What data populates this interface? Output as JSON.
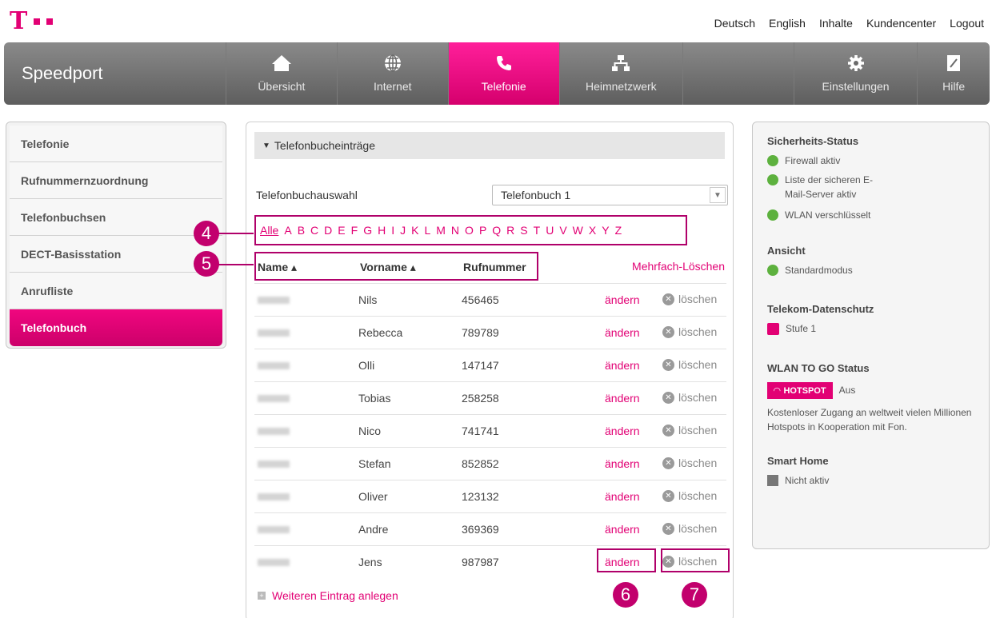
{
  "header": {
    "links": [
      "Deutsch",
      "English",
      "Inhalte",
      "Kundencenter",
      "Logout"
    ]
  },
  "nav": {
    "brand": "Speedport",
    "items": [
      {
        "label": "Übersicht",
        "icon": "home-icon"
      },
      {
        "label": "Internet",
        "icon": "globe-icon"
      },
      {
        "label": "Telefonie",
        "icon": "phone-icon",
        "active": true
      },
      {
        "label": "Heimnetzwerk",
        "icon": "network-icon"
      },
      {
        "label": "Einstellungen",
        "icon": "gear-icon"
      },
      {
        "label": "Hilfe",
        "icon": "help-book-icon"
      }
    ],
    "active_color": "#e20074"
  },
  "sidebar": {
    "items": [
      "Telefonie",
      "Rufnummernzuordnung",
      "Telefonbuchsen",
      "DECT-Basisstation",
      "Anrufliste",
      "Telefonbuch"
    ],
    "active": "Telefonbuch"
  },
  "panel": {
    "title": "Telefonbucheinträge",
    "select_label": "Telefonbuchauswahl",
    "select_value": "Telefonbuch 1",
    "alphabet": [
      "Alle",
      "A",
      "B",
      "C",
      "D",
      "E",
      "F",
      "G",
      "H",
      "I",
      "J",
      "K",
      "L",
      "M",
      "N",
      "O",
      "P",
      "Q",
      "R",
      "S",
      "T",
      "U",
      "V",
      "W",
      "X",
      "Y",
      "Z"
    ],
    "columns": {
      "name": "Name ▴",
      "vorname": "Vorname ▴",
      "rufnummer": "Rufnummer"
    },
    "multi_delete": "Mehrfach-Löschen",
    "edit_label": "ändern",
    "delete_label": "löschen",
    "entries": [
      {
        "vorname": "Nils",
        "rufnummer": "456465"
      },
      {
        "vorname": "Rebecca",
        "rufnummer": "789789"
      },
      {
        "vorname": "Olli",
        "rufnummer": "147147"
      },
      {
        "vorname": "Tobias",
        "rufnummer": "258258"
      },
      {
        "vorname": "Nico",
        "rufnummer": "741741"
      },
      {
        "vorname": "Stefan",
        "rufnummer": "852852"
      },
      {
        "vorname": "Oliver",
        "rufnummer": "123132"
      },
      {
        "vorname": "Andre",
        "rufnummer": "369369"
      },
      {
        "vorname": "Jens",
        "rufnummer": "987987"
      }
    ],
    "add_entry": "Weiteren Eintrag anlegen"
  },
  "callouts": [
    "4",
    "5",
    "6",
    "7"
  ],
  "status": {
    "security_title": "Sicherheits-Status",
    "security_items": [
      "Firewall aktiv",
      "Liste der sicheren E-Mail-Server aktiv",
      "WLAN verschlüsselt"
    ],
    "view_title": "Ansicht",
    "view_item": "Standardmodus",
    "privacy_title": "Telekom-Datenschutz",
    "privacy_item": "Stufe 1",
    "wlan_title": "WLAN TO GO Status",
    "hotspot_badge": "HOTSPOT",
    "hotspot_state": "Aus",
    "wlan_text": "Kostenloser Zugang an weltweit vielen Millionen Hotspots in Kooperation mit Fon.",
    "smarthome_title": "Smart Home",
    "smarthome_item": "Nicht aktiv"
  }
}
